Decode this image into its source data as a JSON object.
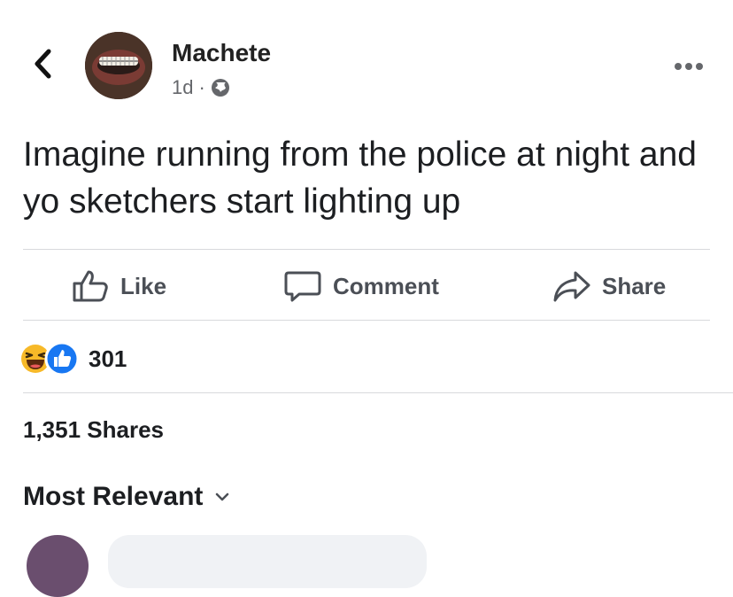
{
  "post": {
    "author": "Machete",
    "time": "1d",
    "separator": "·",
    "audience_icon": "globe-icon",
    "text": "Imagine running from the police at night and yo sketchers start lighting up"
  },
  "actions": {
    "like": "Like",
    "comment": "Comment",
    "share": "Share"
  },
  "reactions": {
    "icons": [
      "haha-icon",
      "like-icon"
    ],
    "count": "301"
  },
  "shares": "1,351 Shares",
  "comments": {
    "sort_label": "Most Relevant"
  },
  "colors": {
    "like_blue": "#1877f2",
    "haha_yellow": "#f7b928",
    "text": "#1c1e21",
    "muted": "#65676b"
  }
}
